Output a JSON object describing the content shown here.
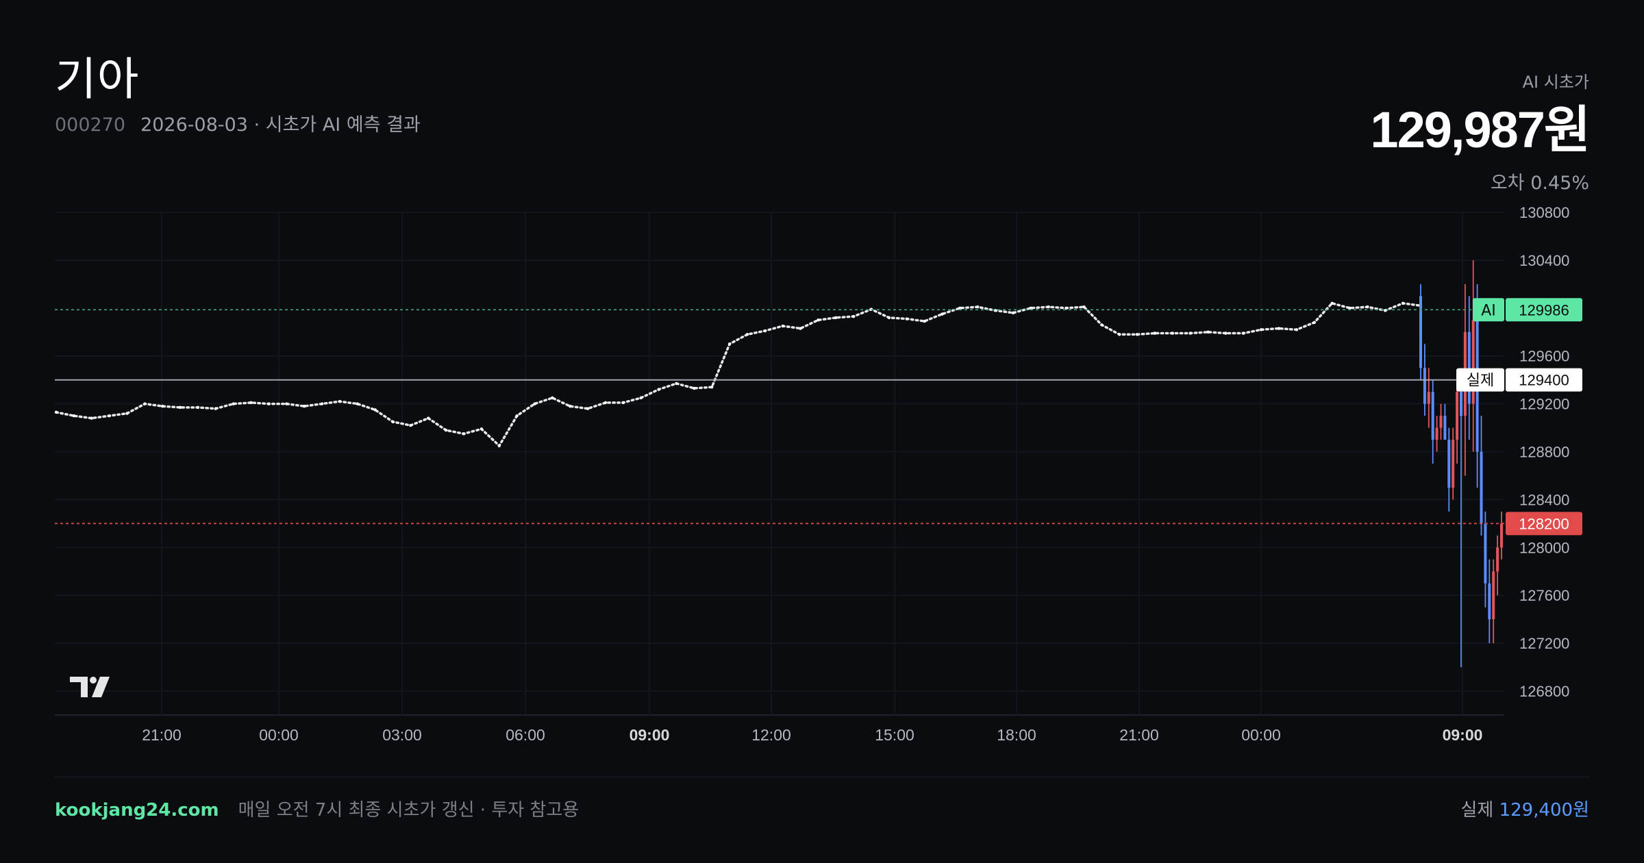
{
  "header": {
    "title": "기아",
    "code": "000270",
    "subtitle": "2026-08-03 · 시초가 AI 예측 결과"
  },
  "summary": {
    "ai_label": "AI 시초가",
    "ai_price": "129,987원",
    "error": "오차 0.45%"
  },
  "footer": {
    "site": "kookjang24.com",
    "note": "매일 오전 7시 최종 시초가 갱신 · 투자 참고용",
    "actual_label": "실제",
    "actual_value": "129,400원"
  },
  "colors": {
    "background": "#0b0c10",
    "ai_accent": "#5ee6a5",
    "up": "#e0565b",
    "down": "#5b8dff",
    "actual_link": "#5b9dff"
  },
  "chart_data": {
    "type": "line",
    "ylim": [
      126600,
      130800
    ],
    "y_ticks": [
      130800,
      130400,
      129600,
      129200,
      128800,
      128400,
      128000,
      127600,
      127200,
      126800
    ],
    "x_ticks": [
      {
        "label": "21:00",
        "bold": false
      },
      {
        "label": "00:00",
        "bold": false
      },
      {
        "label": "03:00",
        "bold": false
      },
      {
        "label": "06:00",
        "bold": false
      },
      {
        "label": "09:00",
        "bold": true
      },
      {
        "label": "12:00",
        "bold": false
      },
      {
        "label": "15:00",
        "bold": false
      },
      {
        "label": "18:00",
        "bold": false
      },
      {
        "label": "21:00",
        "bold": false
      },
      {
        "label": "00:00",
        "bold": false
      },
      {
        "label": "09:00",
        "bold": true
      }
    ],
    "markers": [
      {
        "tag": "AI",
        "value": 129986,
        "style": "ai"
      },
      {
        "tag": "실제",
        "value": 129400,
        "style": "actual"
      },
      {
        "tag": "",
        "value": 128200,
        "style": "close"
      }
    ],
    "series": [
      {
        "name": "overnight",
        "values": [
          129130,
          129100,
          129080,
          129100,
          129120,
          129200,
          129180,
          129170,
          129170,
          129160,
          129200,
          129210,
          129200,
          129200,
          129180,
          129200,
          129220,
          129200,
          129150,
          129050,
          129020,
          129080,
          128980,
          128950,
          128990,
          128850,
          129100,
          129200,
          129250,
          129180,
          129160,
          129210,
          129210,
          129250,
          129320,
          129370,
          129330,
          129340,
          129700,
          129780,
          129810,
          129850,
          129830,
          129900,
          129920,
          129930,
          129990,
          129920,
          129910,
          129890,
          129950,
          130000,
          130010,
          129980,
          129960,
          130000,
          130010,
          130000,
          130010,
          129860,
          129780,
          129780,
          129790,
          129790,
          129790,
          129800,
          129790,
          129790,
          129820,
          129830,
          129820,
          129880,
          130040,
          130000,
          130010,
          129980,
          130040,
          130020
        ]
      },
      {
        "name": "candles",
        "ohlc": [
          [
            130100,
            130200,
            129400,
            129500
          ],
          [
            129500,
            129700,
            129100,
            129200
          ],
          [
            129200,
            129500,
            129000,
            129300
          ],
          [
            129300,
            129400,
            128700,
            128900
          ],
          [
            128900,
            129100,
            128800,
            129000
          ],
          [
            129000,
            129200,
            128900,
            129100
          ],
          [
            129100,
            129200,
            128900,
            128900
          ],
          [
            128900,
            129000,
            128300,
            128500
          ],
          [
            128500,
            129000,
            128400,
            128900
          ],
          [
            128900,
            129400,
            128700,
            129300
          ],
          [
            129300,
            129500,
            127000,
            129100
          ],
          [
            129100,
            130200,
            128600,
            129800
          ],
          [
            129800,
            130100,
            128900,
            129200
          ],
          [
            129200,
            130400,
            128800,
            129900
          ],
          [
            129900,
            130200,
            128500,
            128800
          ],
          [
            128800,
            129100,
            128100,
            128200
          ],
          [
            128200,
            128300,
            127500,
            127700
          ],
          [
            127700,
            127900,
            127200,
            127400
          ],
          [
            127400,
            127900,
            127200,
            127800
          ],
          [
            127800,
            128100,
            127600,
            128000
          ],
          [
            128000,
            128300,
            127900,
            128200
          ]
        ]
      }
    ]
  }
}
